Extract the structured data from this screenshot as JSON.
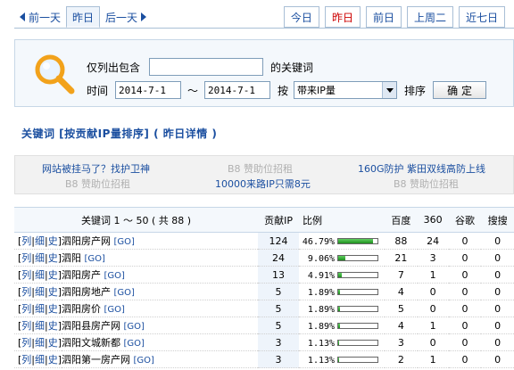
{
  "day_nav": {
    "prev": "前一天",
    "current": "昨日",
    "next": "后一天"
  },
  "quick_tabs": [
    {
      "label": "今日",
      "active": false
    },
    {
      "label": "昨日",
      "active": true
    },
    {
      "label": "前日",
      "active": false
    },
    {
      "label": "上周二",
      "active": false
    },
    {
      "label": "近七日",
      "active": false
    }
  ],
  "search": {
    "list_label": "仅列出包含",
    "keyword_value": "",
    "keyword_suffix": "的关键词",
    "time_label": "时间",
    "date_from": "2014-7-1",
    "date_sep": "～",
    "date_to": "2014-7-1",
    "by_label": "按",
    "sort_value": "带来IP量",
    "sort_label": "排序",
    "confirm_label": "确 定"
  },
  "section_title": "关键词 [按贡献IP量排序] ( 昨日详情 )",
  "ads": {
    "row1": [
      "网站被挂马了？找护卫神",
      "B8 赞助位招租",
      "160G防护 紫田双线高防上线"
    ],
    "row2": [
      "B8 赞助位招租",
      "10000来路IP只需8元",
      "B8 赞助位招租"
    ]
  },
  "table": {
    "headers": {
      "keyword": "关键词 1 ～ 50 ( 共 88 )",
      "ip": "贡献IP",
      "ratio": "比例",
      "baidu": "百度",
      "s360": "360",
      "google": "谷歌",
      "sogou": "搜搜"
    },
    "link_labels": [
      "列",
      "细",
      "史"
    ],
    "go_label": "[GO]",
    "rows": [
      {
        "keyword": "泗阳房产网",
        "ip": "124",
        "ratio": "46.79%",
        "fill": 0.4679,
        "baidu": "88",
        "s360": "24",
        "google": "0",
        "sogou": "0"
      },
      {
        "keyword": "泗阳",
        "ip": "24",
        "ratio": "9.06%",
        "fill": 0.0906,
        "baidu": "21",
        "s360": "3",
        "google": "0",
        "sogou": "0"
      },
      {
        "keyword": "泗阳房产",
        "ip": "13",
        "ratio": "4.91%",
        "fill": 0.0491,
        "baidu": "7",
        "s360": "1",
        "google": "0",
        "sogou": "0"
      },
      {
        "keyword": "泗阳房地产",
        "ip": "5",
        "ratio": "1.89%",
        "fill": 0.0189,
        "baidu": "4",
        "s360": "0",
        "google": "0",
        "sogou": "0"
      },
      {
        "keyword": "泗阳房价",
        "ip": "5",
        "ratio": "1.89%",
        "fill": 0.0189,
        "baidu": "5",
        "s360": "0",
        "google": "0",
        "sogou": "0"
      },
      {
        "keyword": "泗阳县房产网",
        "ip": "5",
        "ratio": "1.89%",
        "fill": 0.0189,
        "baidu": "4",
        "s360": "1",
        "google": "0",
        "sogou": "0"
      },
      {
        "keyword": "泗阳文城新都",
        "ip": "3",
        "ratio": "1.13%",
        "fill": 0.0113,
        "baidu": "3",
        "s360": "0",
        "google": "0",
        "sogou": "0"
      },
      {
        "keyword": "泗阳第一房产网",
        "ip": "3",
        "ratio": "1.13%",
        "fill": 0.0113,
        "baidu": "2",
        "s360": "1",
        "google": "0",
        "sogou": "0"
      }
    ]
  }
}
